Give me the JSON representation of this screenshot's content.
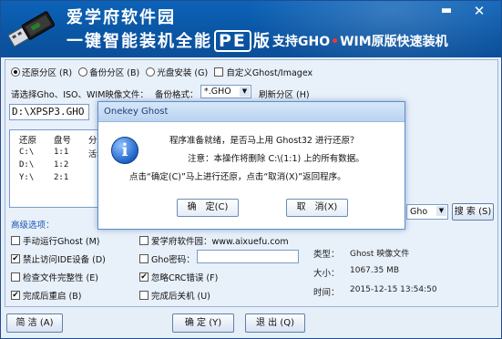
{
  "banner": {
    "title_line1": "爱学府软件园",
    "title_line2_a": "一键智能装机全能",
    "title_line2_pe": "PE",
    "title_line2_b": "版",
    "subtitle_a": "支持GHO",
    "subtitle_dot": "•",
    "subtitle_b": "WIM原版快速装机",
    "min_label": "▬",
    "close_label": "✕"
  },
  "modes": [
    {
      "label": "还原分区 (R)",
      "selected": true
    },
    {
      "label": "备份分区 (B)",
      "selected": false
    },
    {
      "label": "光盘安装 (G)",
      "selected": false
    }
  ],
  "custom_ghost": {
    "label": "自定义Ghost/Imagex",
    "checked": false
  },
  "image_row": {
    "select_label": "请选择Gho、ISO、WIM映像文件：",
    "format_label": "备份格式：",
    "format_value": "*.GHO",
    "refresh_label": "刷新分区 (H)"
  },
  "path_value": "D:\\XPSP3.GHO",
  "table": {
    "headers": [
      "还原",
      "盘号",
      "分区"
    ],
    "rows": [
      {
        "drive": "C:\\",
        "num": "1:1",
        "part": "活动"
      },
      {
        "drive": "D:\\",
        "num": "1:2",
        "part": ""
      },
      {
        "drive": "Y:\\",
        "num": "2:1",
        "part": ""
      }
    ]
  },
  "right_controls": {
    "gho_value": "Gho",
    "search_label": "搜 索 (S)"
  },
  "advanced": {
    "title": "高级选项：",
    "left": [
      {
        "label": "手动运行Ghost (M)",
        "checked": false
      },
      {
        "label": "禁止访问IDE设备 (D)",
        "checked": true
      },
      {
        "label": "检查文件完整性 (E)",
        "checked": false
      },
      {
        "label": "完成后重启 (B)",
        "checked": true
      }
    ],
    "middle": [
      {
        "label": "爱学府软件园：www.aixuefu.com",
        "checked": false
      },
      {
        "label": "Gho密码：",
        "checked": false
      },
      {
        "label": "忽略CRC错误 (F)",
        "checked": true
      },
      {
        "label": "完成后关机 (U)",
        "checked": false
      }
    ]
  },
  "file_info": [
    {
      "label": "类型：",
      "value": "Ghost 映像文件"
    },
    {
      "label": "大小：",
      "value": "1067.35 MB"
    },
    {
      "label": "时间：",
      "value": "2015-12-15  13:54:50"
    }
  ],
  "bottom": {
    "simple_label": "简 洁 (A)",
    "ok_label": "确 定 (Y)",
    "exit_label": "退 出 (Q)"
  },
  "dialog": {
    "title": "Onekey Ghost",
    "line1": "程序准备就绪，是否马上用 Ghost32 进行还原？",
    "line2": "注意：本操作将删除 C:\\(1:1) 上的所有数据。",
    "line3": "点击“确定(C)”马上进行还原，点击“取消(X)”返回程序。",
    "ok_label": "确　定(C)",
    "cancel_label": "取　消(X)",
    "icon_glyph": "i"
  },
  "colors": {
    "banner_blue": "#0a56a5",
    "accent_link": "#1a56b3"
  }
}
